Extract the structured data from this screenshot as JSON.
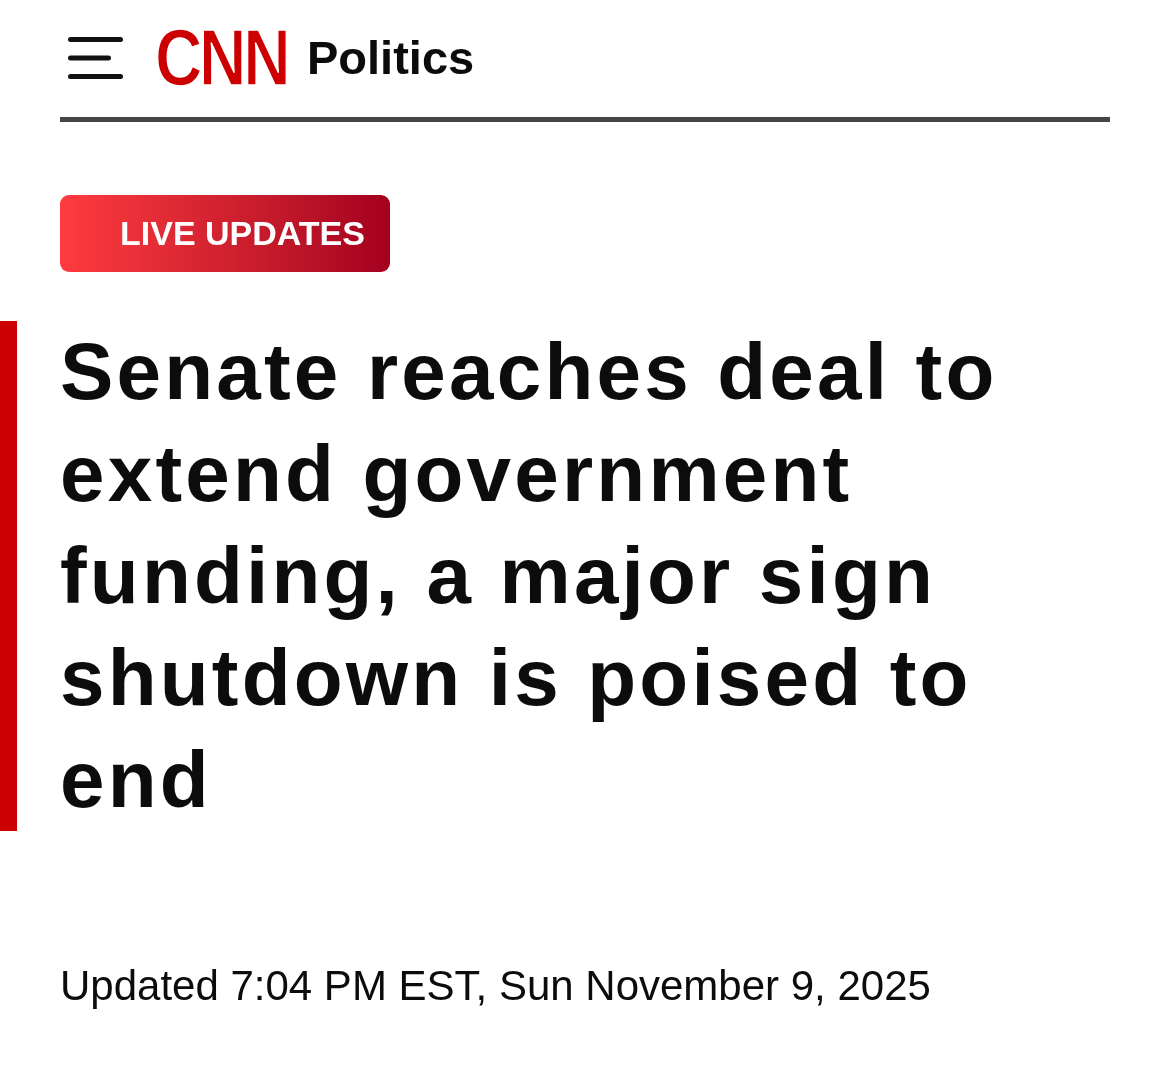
{
  "header": {
    "logo": "CNN",
    "section": "Politics"
  },
  "badge": {
    "label": "LIVE UPDATES"
  },
  "headline": "Senate reaches deal to extend government funding, a major sign shutdown is poised to end",
  "timestamp": "Updated 7:04 PM EST, Sun November 9, 2025"
}
